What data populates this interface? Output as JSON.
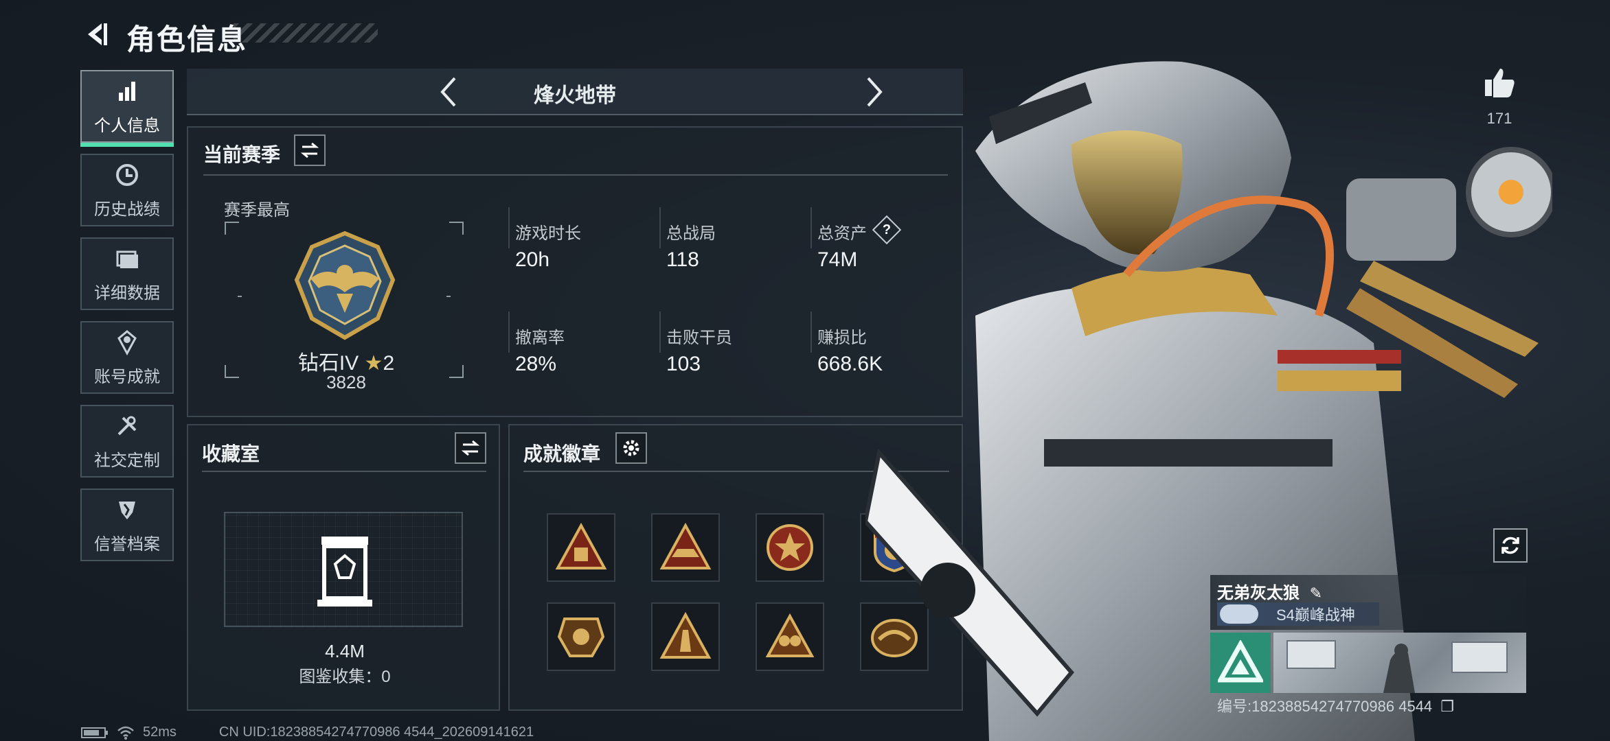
{
  "header": {
    "title": "角色信息"
  },
  "sidebar": {
    "items": [
      {
        "label": "个人信息",
        "icon": "bar-chart-icon",
        "active": true
      },
      {
        "label": "历史战绩",
        "icon": "clock-icon",
        "active": false
      },
      {
        "label": "详细数据",
        "icon": "folder-icon",
        "active": false
      },
      {
        "label": "账号成就",
        "icon": "medal-icon",
        "active": false
      },
      {
        "label": "社交定制",
        "icon": "wrench-icon",
        "active": false
      },
      {
        "label": "信誉档案",
        "icon": "shield-icon",
        "active": false
      }
    ]
  },
  "mode": {
    "name": "烽火地带"
  },
  "season": {
    "title": "当前赛季",
    "best_label": "赛季最高",
    "rank_name": "钻石IV",
    "rank_stars": "2",
    "rank_score": "3828",
    "stats": [
      {
        "label": "游戏时长",
        "value": "20h"
      },
      {
        "label": "总战局",
        "value": "118"
      },
      {
        "label": "总资产",
        "value": "74M",
        "help": "?"
      },
      {
        "label": "撤离率",
        "value": "28%"
      },
      {
        "label": "击败干员",
        "value": "103"
      },
      {
        "label": "赚损比",
        "value": "668.6K"
      }
    ]
  },
  "collection": {
    "title": "收藏室",
    "value": "4.4M",
    "collect_label": "图鉴收集：0"
  },
  "badges": {
    "title": "成就徽章",
    "items": [
      "badge-1",
      "badge-2",
      "badge-3",
      "badge-4",
      "badge-5",
      "badge-6",
      "badge-7",
      "badge-8"
    ]
  },
  "like": {
    "count": "171"
  },
  "player": {
    "name": "无弟灰太狼",
    "title": "S4巅峰战神",
    "uid": "编号:18238854274770986 4544"
  },
  "status": {
    "ping": "52ms",
    "uid_line": "CN UID:18238854274770986 4544_202609141621"
  },
  "colors": {
    "accent": "#52e0b0",
    "gold": "#c9a14a"
  }
}
